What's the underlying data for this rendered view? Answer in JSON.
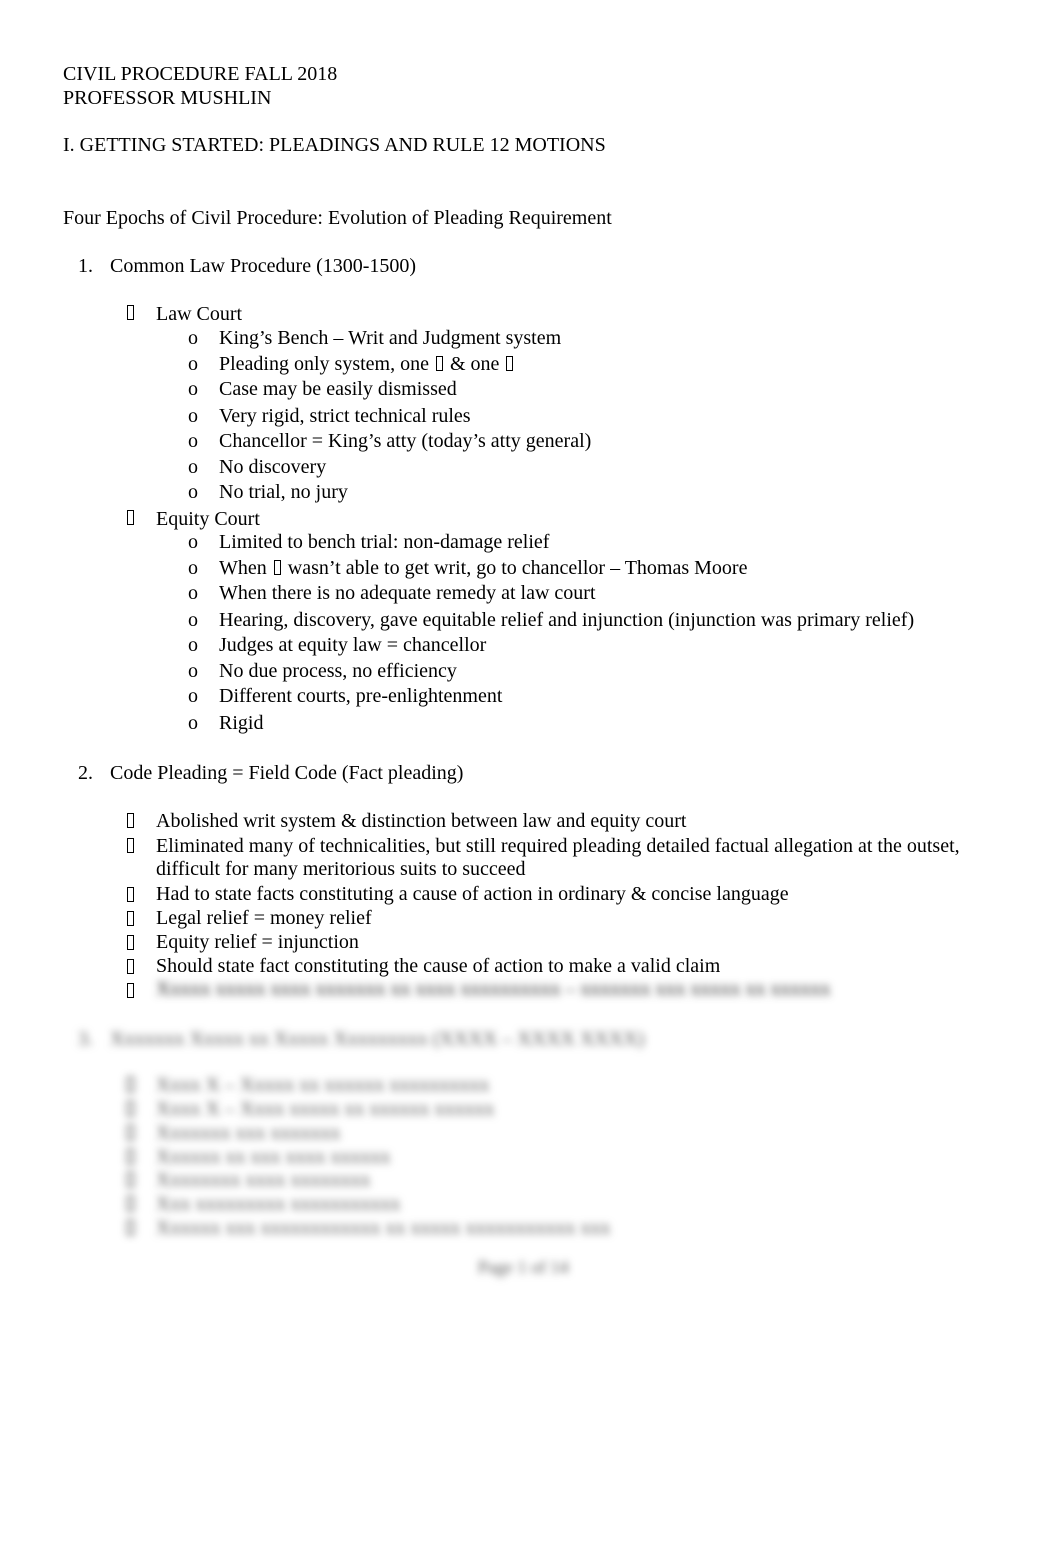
{
  "header": {
    "course": "CIVIL PROCEDURE FALL 2018",
    "professor": "PROFESSOR MUSHLIN"
  },
  "section_title": "I.  GETTING STARTED: PLEADINGS AND RULE 12 MOTIONS",
  "subtitle": "Four Epochs of Civil Procedure: Evolution of Pleading Requirement",
  "epoch1": {
    "number": "1.",
    "title": "Common Law Procedure (1300-1500)",
    "law_court": {
      "label": "Law Court",
      "items": [
        "King’s Bench – Writ and Judgment system",
        "Pleading only system, one",
        "Case may be easily dismissed",
        "Very rigid, strict technical rules",
        "Chancellor = King’s atty (today’s atty general)",
        "No discovery",
        "No trial, no jury"
      ],
      "item2_mid": "& one"
    },
    "equity_court": {
      "label": "Equity Court",
      "items": [
        "Limited to bench trial: non-damage relief",
        "When",
        "When there is no adequate remedy at law court",
        "Hearing, discovery, gave equitable relief and injunction (injunction was primary relief)",
        "Judges at equity law = chancellor",
        "No due process, no efficiency",
        "Different courts, pre-enlightenment",
        "Rigid"
      ],
      "item2_rest": "wasn’t able to get writ, go to chancellor – Thomas Moore"
    }
  },
  "epoch2": {
    "number": "2.",
    "title": "Code Pleading = Field Code (Fact pleading)",
    "items": [
      "Abolished writ system & distinction between law and equity court",
      "Eliminated many of technicalities, but still required pleading detailed factual allegation at the outset,",
      "Had to state facts constituting a cause of action in ordinary & concise language",
      "Legal relief = money relief",
      "Equity relief = injunction",
      "Should state fact constituting the cause of action to make a valid claim"
    ],
    "item2_cont": "difficult for many meritorious suits to succeed"
  },
  "sub_bullet_marker": "o",
  "blurred_placeholder": {
    "epoch2_last_item": "Xxxxx xxxxx xxxx xxxxxxx xx xxxx xxxxxxxxxx – xxxxxxx xxx xxxxx xx xxxxxx",
    "epoch3_number": "3.",
    "epoch3_title": "Xxxxxxx Xxxxx xx Xxxxx Xxxxxxxxx (XXXX – XXXX XXXX)",
    "epoch3_items": [
      "Xxxx X – Xxxxx xx xxxxxx xxxxxxxxxx",
      "Xxxx X – Xxxx xxxxx xx xxxxxx xxxxxx",
      "Xxxxxxx xxx xxxxxxx",
      "Xxxxxx xx xxx xxxx xxxxxx",
      "Xxxxxxxx xxxx xxxxxxxx",
      "Xxx xxxxxxxxx xxxxxxxxxxx",
      "Xxxxxx xxx xxxxxxxxxxxx xx xxxxx xxxxxxxxxxx xxx"
    ],
    "page_number": "Page 1 of 14"
  }
}
